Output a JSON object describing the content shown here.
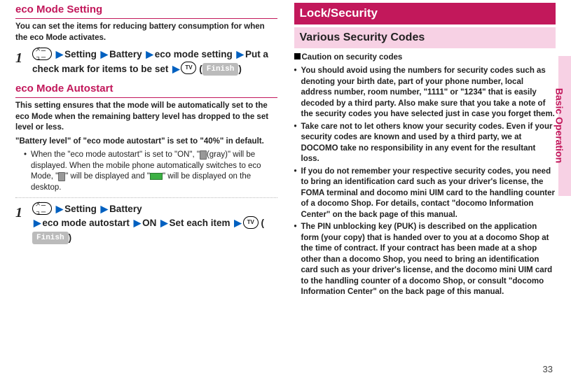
{
  "left": {
    "heading1": "eco Mode Setting",
    "intro1": "You can set the items for reducing battery consumption for when the eco Mode activates.",
    "step1_num": "1",
    "step1_menu": "メニュー",
    "step1_s1": "Setting",
    "step1_s2": "Battery",
    "step1_s3": "eco mode setting",
    "step1_s4": "Put a check mark for items to be set",
    "tv_label": "TV",
    "finish": "Finish",
    "heading2": "eco Mode Autostart",
    "intro2a": "This setting ensures that the mode will be automatically set to the eco Mode when the remaining battery level has dropped to the set level or less.",
    "intro2b": "\"Battery level\" of \"eco mode autostart\" is set to \"40%\" in default.",
    "bullet2": "When the \"eco mode autostart\" is set to \"ON\", \"",
    "bullet2_after1": "(gray)\" will be displayed. When the mobile phone automatically switches to eco Mode, \"",
    "bullet2_after2": "\" will be displayed and \"",
    "bullet2_after3": "\" will be displayed on the desktop.",
    "step2_num": "1",
    "step2_s1": "Setting",
    "step2_s2": "Battery",
    "step2_s3": "eco mode autostart",
    "step2_s4": "ON",
    "step2_s5": "Set each item"
  },
  "right": {
    "blockTitle": "Lock/Security",
    "subTitle": "Various Security Codes",
    "cautionHead": "Caution on security codes",
    "b1": "You should avoid using the numbers for security codes such as denoting your birth date, part of your phone number, local address number, room number, \"1111\" or \"1234\" that is easily decoded by a third party. Also make sure that you take a note of the security codes you have selected just in case you forget them.",
    "b2": "Take care not to let others know your security codes. Even if your security codes are known and used by a third party, we at DOCOMO take no responsibility in any event for the resultant loss.",
    "b3": "If you do not remember your respective security codes, you need to bring an identification card such as your driver's license, the FOMA terminal and docomo mini UIM card to the handling counter of a docomo Shop. For details, contact \"docomo Information Center\" on the back page of this manual.",
    "b4": "The PIN unblocking key (PUK) is described on the application form (your copy) that is handed over to you at a docomo Shop at the time of contract. If your contract has been made at a shop other than a docomo Shop, you need to bring an identification card such as your driver's license, and the docomo mini UIM card to the handling counter of a docomo Shop, or consult \"docomo Information Center\" on the back page of this manual."
  },
  "side": "Basic Operation",
  "pageNum": "33"
}
